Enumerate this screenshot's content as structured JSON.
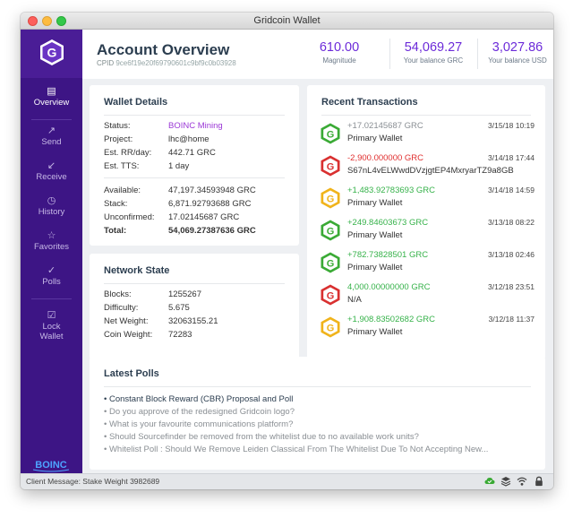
{
  "window": {
    "title": "Gridcoin Wallet"
  },
  "sidebar": {
    "items": [
      {
        "label": "Overview",
        "icon": "overview-icon",
        "active": true
      },
      {
        "label": "Send",
        "icon": "send-arrow-icon"
      },
      {
        "label": "Receive",
        "icon": "receive-arrow-icon"
      },
      {
        "label": "History",
        "icon": "clock-icon"
      },
      {
        "label": "Favorites",
        "icon": "star-icon"
      },
      {
        "label": "Polls",
        "icon": "checkmark-icon"
      }
    ],
    "lock": {
      "line1": "Lock",
      "line2": "Wallet",
      "icon": "lock-icon"
    },
    "footer_logo": "BOINC"
  },
  "header": {
    "title": "Account Overview",
    "cpid_label": "CPID",
    "cpid_value": "9ce6f19e20f69790601c9bf9c0b03928",
    "stats": [
      {
        "value": "610.00",
        "label": "Magnitude"
      },
      {
        "value": "54,069.27",
        "label": "Your balance GRC"
      },
      {
        "value": "3,027.86",
        "label": "Your balance USD"
      }
    ]
  },
  "wallet_details": {
    "title": "Wallet Details",
    "rows_top": [
      {
        "k": "Status:",
        "v": "BOINC Mining"
      },
      {
        "k": "Project:",
        "v": "lhc@home"
      },
      {
        "k": "Est. RR/day:",
        "v": "442.71 GRC"
      },
      {
        "k": "Est. TTS:",
        "v": "1 day"
      }
    ],
    "rows_bottom": [
      {
        "k": "Available:",
        "v": "47,197.34593948 GRC"
      },
      {
        "k": "Stack:",
        "v": "6,871.92793688 GRC"
      },
      {
        "k": "Unconfirmed:",
        "v": "17.02145687 GRC"
      },
      {
        "k": "Total:",
        "v": "54,069.27387636 GRC"
      }
    ]
  },
  "network_state": {
    "title": "Network State",
    "rows": [
      {
        "k": "Blocks:",
        "v": "1255267"
      },
      {
        "k": "Difficulty:",
        "v": "5.675"
      },
      {
        "k": "Net Weight:",
        "v": "32063155.21"
      },
      {
        "k": "Coin Weight:",
        "v": "72283"
      }
    ]
  },
  "recent_transactions": {
    "title": "Recent Transactions",
    "items": [
      {
        "amount": "+17.02145687 GRC",
        "date": "3/15/18 10:19",
        "account": "Primary Wallet",
        "kind": "pending",
        "coin_color": "#3aaa35"
      },
      {
        "amount": "-2,900.000000 GRC",
        "date": "3/14/18 17:44",
        "account": "S67nL4vELWwdDVzjgtEP4MxryarTZ9a8GB",
        "kind": "neg",
        "coin_color": "#d93030"
      },
      {
        "amount": "+1,483.92783693 GRC",
        "date": "3/14/18 14:59",
        "account": "Primary Wallet",
        "kind": "pos",
        "coin_color": "#f0b31a"
      },
      {
        "amount": "+249.84603673 GRC",
        "date": "3/13/18 08:22",
        "account": "Primary Wallet",
        "kind": "pos",
        "coin_color": "#3aaa35"
      },
      {
        "amount": "+782.73828501 GRC",
        "date": "3/13/18 02:46",
        "account": "Primary Wallet",
        "kind": "pos",
        "coin_color": "#3aaa35"
      },
      {
        "amount": "4,000.00000000 GRC",
        "date": "3/12/18 23:51",
        "account": "N/A",
        "kind": "pos",
        "coin_color": "#d93030"
      },
      {
        "amount": "+1,908.83502682 GRC",
        "date": "3/12/18 11:37",
        "account": "Primary Wallet",
        "kind": "pos",
        "coin_color": "#f0b31a"
      }
    ]
  },
  "latest_polls": {
    "title": "Latest Polls",
    "items": [
      "Constant Block Reward (CBR) Proposal and Poll",
      "Do you approve of the redesigned Gridcoin logo?",
      "What is your favourite communications platform?",
      "Should Sourcefinder be removed from the whitelist due to no available work units?",
      "Whitelist Poll : Should We Remove Leiden Classical From The Whitelist Due To Not Accepting New..."
    ]
  },
  "statusbar": {
    "message": "Client Message: Stake Weight 3982689",
    "icons": [
      "cloud-sync-icon",
      "stack-icon",
      "wifi-icon",
      "lock-icon"
    ]
  },
  "colors": {
    "sidebar": "#3d1585",
    "accent": "#6c2bd9",
    "positive": "#36b24a",
    "negative": "#e03030"
  }
}
